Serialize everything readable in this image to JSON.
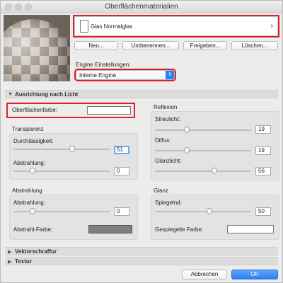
{
  "window": {
    "title": "Oberflächenmaterialien"
  },
  "material": {
    "name": "Glas Normalglas"
  },
  "buttons": {
    "new": "Neu...",
    "rename": "Umbenennen...",
    "share": "Freigeben...",
    "delete": "Löschen..."
  },
  "engine": {
    "label": "Engine Einstellungen:",
    "value": "Interne Engine"
  },
  "sections": {
    "orientation": "Ausrichtung nach Licht",
    "vector_hatch": "Vektorschraffur",
    "texture": "Textur"
  },
  "surface_color": {
    "label": "Oberflächenfarbe:",
    "color": "#ffffff"
  },
  "transparency": {
    "title": "Transparenz",
    "opacity_label": "Durchlässigkeit:",
    "opacity_value": "51",
    "falloff_label": "Abstrahlung:",
    "falloff_value": "0"
  },
  "emission": {
    "title": "Abstrahlung",
    "falloff_label": "Abstrahlung:",
    "falloff_value": "0",
    "color_label": "Abstrahl-Farbe:",
    "color": "#808080"
  },
  "reflection": {
    "title": "Reflexion",
    "ambient_label": "Streulicht:",
    "ambient_value": "19",
    "diffuse_label": "Diffus:",
    "diffuse_value": "19",
    "specular_label": "Glanzlicht:",
    "specular_value": "56"
  },
  "gloss": {
    "title": "Glanz",
    "shine_label": "Spiegelnd:",
    "shine_value": "50",
    "mirror_color_label": "Gespiegelte Farbe:",
    "mirror_color": "#ffffff"
  },
  "footer": {
    "cancel": "Abbrechen",
    "ok": "OK"
  },
  "icons": {
    "close": "close-icon",
    "minimize": "minimize-icon",
    "zoom": "zoom-icon",
    "chevron": "chevron-right-icon",
    "updown": "updown-arrows-icon",
    "disclosure_open": "triangle-down-icon",
    "disclosure_closed": "triangle-right-icon"
  },
  "colors": {
    "accent": "#2f7ff6",
    "highlight": "#d8232a"
  }
}
